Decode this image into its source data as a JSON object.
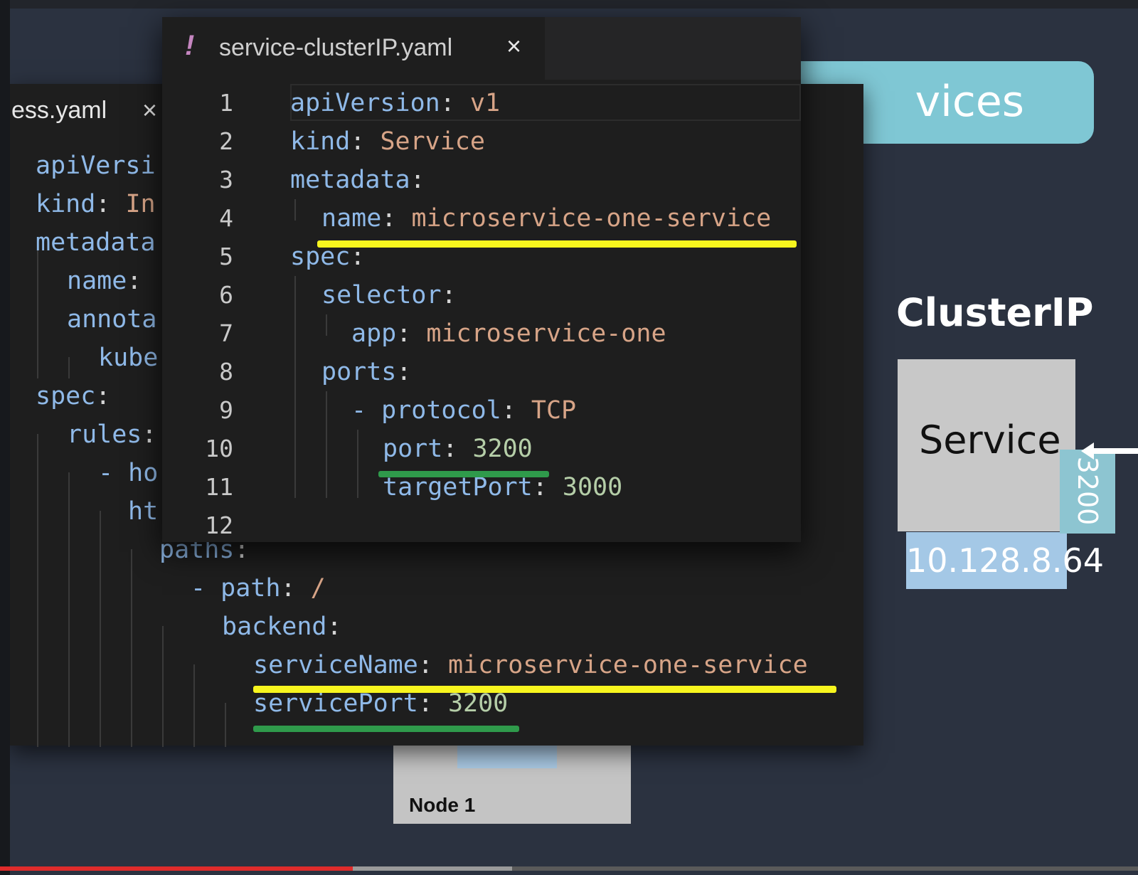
{
  "slide": {
    "header_text": "vices",
    "cluster_label": "ClusterIP",
    "service_label": "Service",
    "service_ip": "10.128.8.64",
    "service_port": "3200",
    "node_label": "Node 1"
  },
  "back_editor": {
    "tab_name": "ess.yaml",
    "tab_close": "×",
    "lines": [
      {
        "key": "apiVersi",
        "sep": "",
        "val": ""
      },
      {
        "key": "kind",
        "sep": ": ",
        "val": "In"
      },
      {
        "key": "metadata",
        "sep": "",
        "val": ""
      },
      {
        "key": "name",
        "sep": ":",
        "val": ""
      },
      {
        "key": "annota",
        "sep": "",
        "val": ""
      },
      {
        "key": "kube",
        "sep": "",
        "val": ""
      },
      {
        "key": "spec",
        "sep": ":",
        "val": ""
      },
      {
        "key": "rules",
        "sep": ":",
        "val": ""
      },
      {
        "key": "- ho",
        "sep": "",
        "val": ""
      },
      {
        "key": "ht",
        "sep": "",
        "val": ""
      },
      {
        "key": "paths",
        "sep": ":",
        "val": ""
      },
      {
        "key": "- path",
        "sep": ": ",
        "val": "/"
      },
      {
        "key": "backend",
        "sep": ":",
        "val": ""
      },
      {
        "key": "serviceName",
        "sep": ": ",
        "val": "microservice-one-service"
      },
      {
        "key": "servicePort",
        "sep": ": ",
        "val": "3200"
      }
    ]
  },
  "front_editor": {
    "tab_icon": "!",
    "tab_name": "service-clusterIP.yaml",
    "tab_close": "×",
    "line_numbers": [
      "1",
      "2",
      "3",
      "4",
      "5",
      "6",
      "7",
      "8",
      "9",
      "10",
      "11",
      "12"
    ],
    "lines": [
      {
        "key": "apiVersion",
        "sep": ": ",
        "val": "v1"
      },
      {
        "key": "kind",
        "sep": ": ",
        "val": "Service"
      },
      {
        "key": "metadata",
        "sep": ":",
        "val": ""
      },
      {
        "key": "name",
        "sep": ": ",
        "val": "microservice-one-service"
      },
      {
        "key": "spec",
        "sep": ":",
        "val": ""
      },
      {
        "key": "selector",
        "sep": ":",
        "val": ""
      },
      {
        "key": "app",
        "sep": ": ",
        "val": "microservice-one"
      },
      {
        "key": "ports",
        "sep": ":",
        "val": ""
      },
      {
        "key": "- protocol",
        "sep": ": ",
        "val": "TCP"
      },
      {
        "key": "port",
        "sep": ": ",
        "val": "3200"
      },
      {
        "key": "targetPort",
        "sep": ": ",
        "val": "3000"
      },
      {
        "key": "",
        "sep": "",
        "val": ""
      }
    ]
  },
  "video": {
    "progress_fraction": 0.31
  },
  "colors": {
    "yaml_key": "#8fb9e8",
    "yaml_string": "#d7a487",
    "yaml_number": "#b5cea8",
    "highlight_yellow": "#f7f51e",
    "highlight_green": "#2f9a4b"
  }
}
